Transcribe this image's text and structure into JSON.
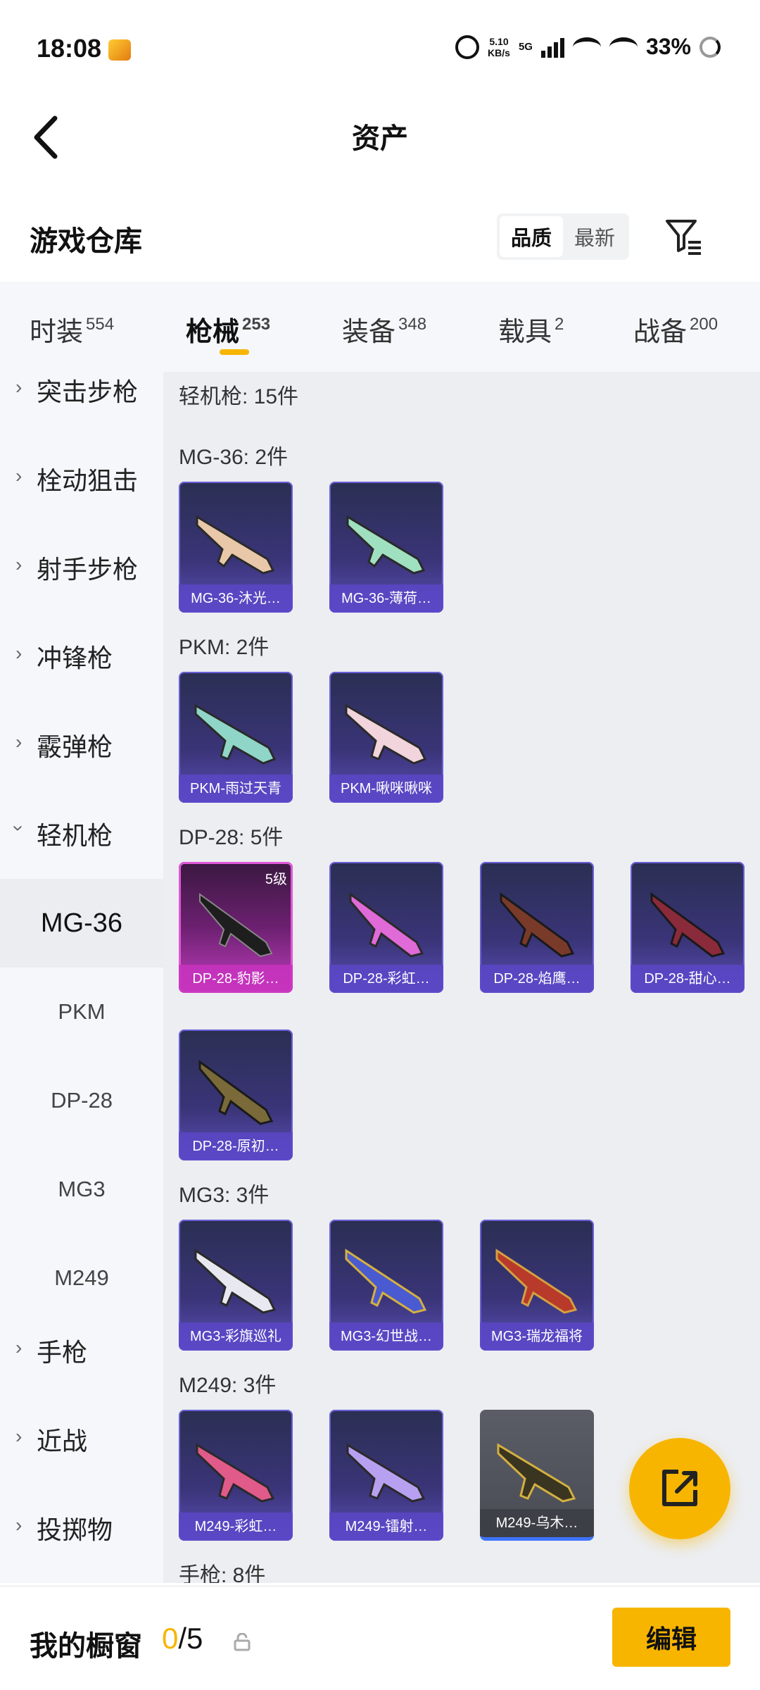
{
  "status_bar": {
    "time": "18:08",
    "net_speed_value": "5.10",
    "net_speed_unit": "KB/s",
    "network": "5G",
    "battery": "33%"
  },
  "header": {
    "title": "资产"
  },
  "warehouse": {
    "title": "游戏仓库",
    "sort_options": [
      "品质",
      "最新"
    ],
    "sort_selected": "品质"
  },
  "tabs": [
    {
      "label": "时装",
      "count": "554"
    },
    {
      "label": "枪械",
      "count": "253",
      "active": true
    },
    {
      "label": "装备",
      "count": "348"
    },
    {
      "label": "载具",
      "count": "2"
    },
    {
      "label": "战备",
      "count": "200"
    }
  ],
  "sidebar": {
    "categories": [
      "突击步枪",
      "栓动狙击",
      "射手步枪",
      "冲锋枪",
      "霰弹枪",
      "轻机枪",
      "手枪",
      "近战",
      "投掷物"
    ],
    "expanded": "轻机枪",
    "sub_items": [
      "MG-36",
      "PKM",
      "DP-28",
      "MG3",
      "M249"
    ],
    "sub_selected": "MG-36"
  },
  "content": {
    "top_heading": "轻机枪: 15件",
    "sections": [
      {
        "heading": "MG-36: 2件",
        "items": [
          "MG-36-沐光…",
          "MG-36-薄荷…"
        ]
      },
      {
        "heading": "PKM: 2件",
        "items": [
          "PKM-雨过天青",
          "PKM-啾咪啾咪"
        ]
      },
      {
        "heading": "DP-28: 5件",
        "items": [
          "DP-28-豹影…",
          "DP-28-彩虹…",
          "DP-28-焰鹰…",
          "DP-28-甜心…",
          "DP-28-原初…"
        ],
        "first_level": "5级"
      },
      {
        "heading": "MG3: 3件",
        "items": [
          "MG3-彩旗巡礼",
          "MG3-幻世战…",
          "MG3-瑞龙福将"
        ]
      },
      {
        "heading": "M249: 3件",
        "items": [
          "M249-彩虹…",
          "M249-镭射…",
          "M249-乌木…"
        ]
      }
    ],
    "next_heading": "手枪: 8件"
  },
  "bottom": {
    "label": "我的橱窗",
    "count_current": "0",
    "count_total": "/5",
    "edit_label": "编辑"
  },
  "colors": {
    "accent": "#f7b500",
    "card_purple": "#3a3478",
    "card_pink": "#c23fc0"
  }
}
